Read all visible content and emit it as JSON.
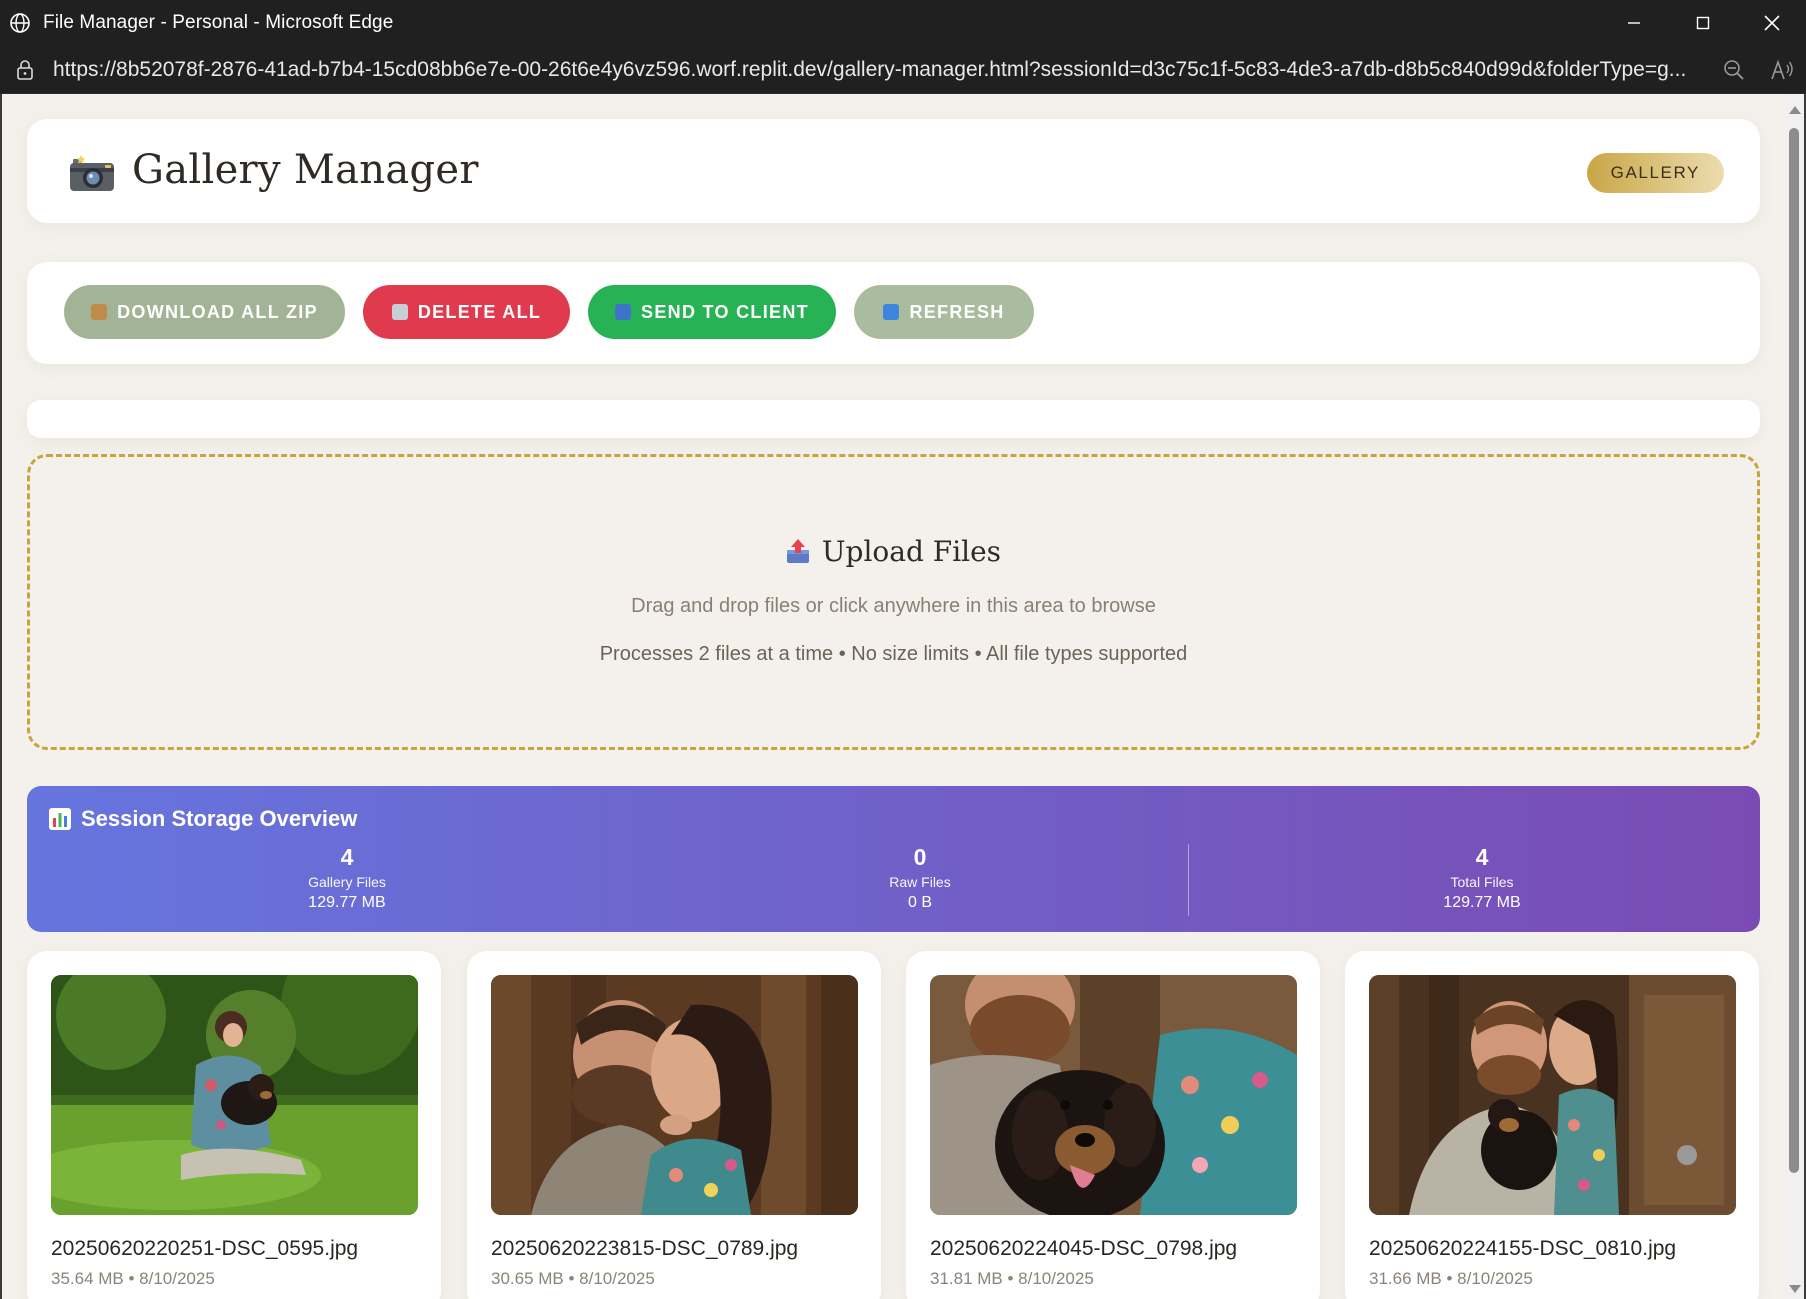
{
  "window": {
    "title": "File Manager - Personal - Microsoft Edge",
    "url": "https://8b52078f-2876-41ad-b7b4-15cd08bb6e7e-00-26t6e4y6vz596.worf.replit.dev/gallery-manager.html?sessionId=d3c75c1f-5c83-4de3-a7db-d8b5c840d99d&folderType=g..."
  },
  "header": {
    "title": "Gallery Manager",
    "badge": "GALLERY",
    "icon": "camera-icon"
  },
  "actions": {
    "download_all": "DOWNLOAD ALL ZIP",
    "delete_all": "DELETE ALL",
    "send_to_client": "SEND TO CLIENT",
    "refresh": "REFRESH"
  },
  "upload": {
    "title": "Upload Files",
    "subtitle": "Drag and drop files or click anywhere in this area to browse",
    "info": "Processes 2 files at a time • No size limits • All file types supported"
  },
  "storage": {
    "title": "Session Storage Overview",
    "stats": [
      {
        "count": "4",
        "label": "Gallery Files",
        "size": "129.77 MB"
      },
      {
        "count": "0",
        "label": "Raw Files",
        "size": "0 B"
      },
      {
        "count": "4",
        "label": "Total Files",
        "size": "129.77 MB"
      }
    ]
  },
  "files": [
    {
      "name": "20250620220251-DSC_0595.jpg",
      "meta": "35.64 MB • 8/10/2025"
    },
    {
      "name": "20250620223815-DSC_0789.jpg",
      "meta": "30.65 MB • 8/10/2025"
    },
    {
      "name": "20250620224045-DSC_0798.jpg",
      "meta": "31.81 MB • 8/10/2025"
    },
    {
      "name": "20250620224155-DSC_0810.jpg",
      "meta": "31.66 MB • 8/10/2025"
    }
  ],
  "colors": {
    "accent_gold": "#c9a646",
    "delete_red": "#e03a4e",
    "send_green": "#28b256",
    "muted_green": "#a3b496",
    "stats_gradient_start": "#6675de",
    "stats_gradient_end": "#7a4cb3",
    "page_background": "#f4f1ec"
  }
}
